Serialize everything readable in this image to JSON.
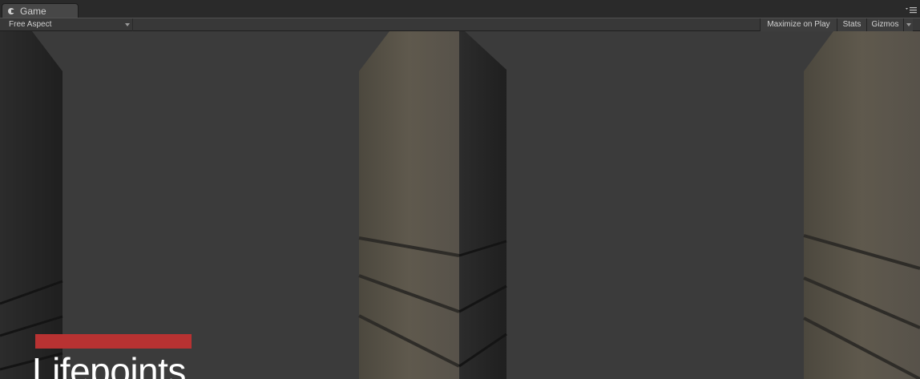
{
  "window": {
    "tab_label": "Game",
    "tab_icon": "unity-game-icon",
    "panel_menu_icon": "panel-menu-icon"
  },
  "toolbar": {
    "aspect_value": "Free Aspect",
    "maximize_label": "Maximize on Play",
    "stats_label": "Stats",
    "gizmos_label": "Gizmos"
  },
  "hud": {
    "life_label": "Lifepoints",
    "health_fraction": 1.0,
    "health_color": "#b83232"
  },
  "colors": {
    "background": "#3b3b3b",
    "editor_chrome": "#383838",
    "wall_light": "#5e584c",
    "wall_dark": "#262626"
  }
}
